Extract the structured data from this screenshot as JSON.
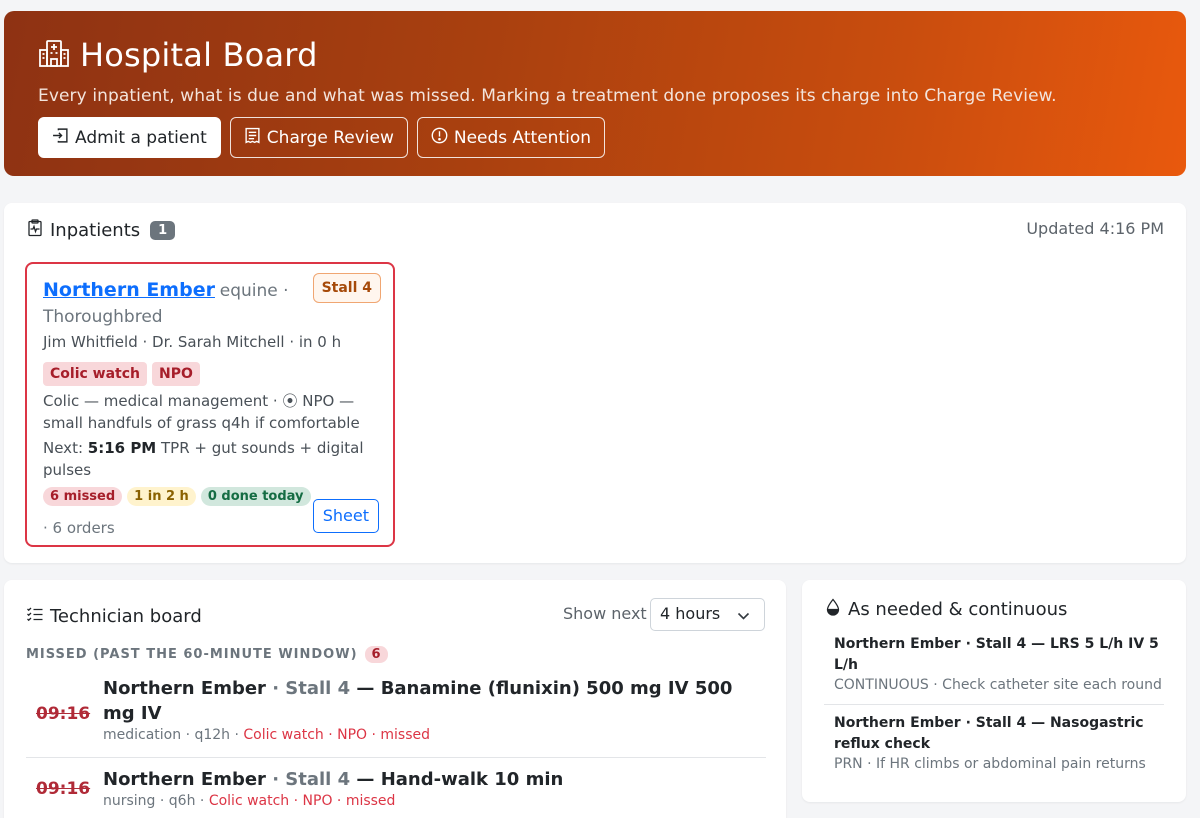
{
  "hero": {
    "title": "Hospital Board",
    "subtitle": "Every inpatient, what is due and what was missed. Marking a treatment done proposes its charge into Charge Review.",
    "buttons": {
      "admit": "Admit a patient",
      "charge_review": "Charge Review",
      "needs_attention": "Needs Attention"
    },
    "gradient_colors": [
      "#8e3213",
      "#e9590d"
    ]
  },
  "inpatients": {
    "title": "Inpatients",
    "count": "1",
    "updated": "Updated 4:16 PM",
    "patient": {
      "name": "Northern Ember",
      "species": "equine · Thoroughbred",
      "stall": "Stall 4",
      "owner_line": "Jim Whitfield · Dr. Sarah Mitchell · in 0 h",
      "tags": [
        "Colic watch",
        "NPO"
      ],
      "diagnosis": "Colic — medical management · ⦿ NPO — small handfuls of grass q4h if comfortable",
      "next_label": "Next:",
      "next_time": "5:16 PM",
      "next_task": "TPR + gut sounds + digital pulses",
      "stats": {
        "missed": "6 missed",
        "due": "1 in 2 h",
        "done": "0 done today"
      },
      "orders": "· 6 orders",
      "sheet_button": "Sheet"
    }
  },
  "technician_board": {
    "title": "Technician board",
    "show_next_label": "Show next",
    "show_next_value": "4 hours",
    "missed_header": "MISSED (PAST THE 60-MINUTE WINDOW)",
    "missed_count": "6",
    "tasks": [
      {
        "time": "09:16",
        "patient": "Northern Ember",
        "sep": " · ",
        "stall": "Stall 4",
        "treatment": " — Banamine (flunixin) 500 mg IV 500 mg IV",
        "meta_plain": "medication · q12h · ",
        "meta_red": "Colic watch · NPO · missed"
      },
      {
        "time": "09:16",
        "patient": "Northern Ember",
        "sep": " · ",
        "stall": "Stall 4",
        "treatment": " — Hand-walk 10 min",
        "meta_plain": "nursing · q6h · ",
        "meta_red": "Colic watch · NPO · missed"
      }
    ]
  },
  "prn": {
    "title": "As needed & continuous",
    "items": [
      {
        "title": "Northern Ember · Stall 4 — LRS 5 L/h IV 5 L/h",
        "meta": "CONTINUOUS · Check catheter site each round"
      },
      {
        "title": "Northern Ember · Stall 4 — Nasogastric reflux check",
        "meta": "PRN · If HR climbs or abdominal pain returns"
      }
    ]
  }
}
